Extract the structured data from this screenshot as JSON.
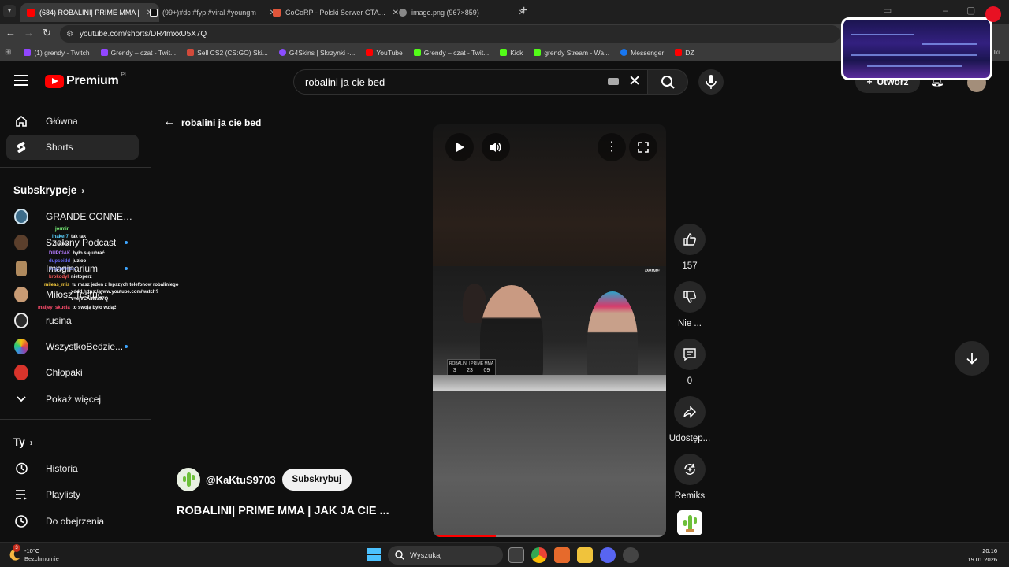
{
  "browser": {
    "tabs": [
      {
        "title": "(684) ROBALINI| PRIME MMA |",
        "active": true,
        "color": "#ff0000"
      },
      {
        "title": "(99+)#dc #fyp #viral #youngm",
        "active": false,
        "color": "#111111"
      },
      {
        "title": "CoCoRP - Polski Serwer GTA RP",
        "active": false,
        "color": "#e0553a"
      },
      {
        "title": "image.png (967×859)",
        "active": false,
        "color": "#888888"
      }
    ],
    "url": "youtube.com/shorts/DR4mxxU5X7Q",
    "bookmarks": [
      {
        "label": "(1) grendy - Twitch",
        "color": "#9146ff"
      },
      {
        "label": "Grendy – czat - Twit...",
        "color": "#9146ff"
      },
      {
        "label": "Sell CS2 (CS:GO) Ski...",
        "color": "#d24a3a"
      },
      {
        "label": "G4Skins | Skrzynki -...",
        "color": "#8a4dff"
      },
      {
        "label": "YouTube",
        "color": "#ff0000"
      },
      {
        "label": "Grendy – czat - Twit...",
        "color": "#53fc18"
      },
      {
        "label": "Kick",
        "color": "#53fc18"
      },
      {
        "label": "grendy Stream - Wa...",
        "color": "#53fc18"
      },
      {
        "label": "Messenger",
        "color": "#1877f2"
      },
      {
        "label": "DZ",
        "color": "#ff0000"
      }
    ],
    "bookmarks_more": "lki"
  },
  "header": {
    "logo_text": "Premium",
    "region": "PL",
    "search_value": "robalini ja cie bed",
    "create_label": "Utwórz"
  },
  "sidebar": {
    "main": [
      {
        "label": "Główna",
        "icon": "home-icon",
        "active": false
      },
      {
        "label": "Shorts",
        "icon": "shorts-icon",
        "active": true
      }
    ],
    "subs_title": "Subskrypcje",
    "subs": [
      {
        "label": "GRANDE CONNECT...",
        "dot": false,
        "color": "#3c6c8a"
      },
      {
        "label": "Szalony Podcast",
        "dot": true,
        "color": "#5b3f2c"
      },
      {
        "label": "Imaginarium",
        "dot": true,
        "color": "#b08a5e"
      },
      {
        "label": "Miłosz Testue",
        "dot": false,
        "color": "#c89b74"
      },
      {
        "label": "rusina",
        "dot": false,
        "color": "#2a2a2a"
      },
      {
        "label": "WszystkoBedzie...",
        "dot": true,
        "color": "#8a4fc7"
      },
      {
        "label": "Chłopaki",
        "dot": false,
        "color": "#d9342b"
      },
      {
        "label": "Pokaż więcej",
        "dot": false,
        "color": ""
      }
    ],
    "you_title": "Ty",
    "you": [
      {
        "label": "Historia",
        "icon": "history-icon"
      },
      {
        "label": "Playlisty",
        "icon": "playlist-icon"
      },
      {
        "label": "Do obejrzenia",
        "icon": "watch-later-icon"
      }
    ]
  },
  "chat": [
    {
      "user": "jormin",
      "text": "",
      "color": "#7fff7f"
    },
    {
      "user": "lnaker7",
      "text": "tak tak",
      "color": "#5ad1ff"
    },
    {
      "user": "rurnix",
      "text": "",
      "color": "#ffffff"
    },
    {
      "user": "DUPCIAK",
      "text": "było się ubrać",
      "color": "#b57cff"
    },
    {
      "user": "dupsoidd",
      "text": "juzioo",
      "color": "#6b6bff"
    },
    {
      "user": "majsonman",
      "text": "",
      "color": "#9aa8ff"
    },
    {
      "user": "krokodyl",
      "text": "nietoperz",
      "color": "#ff5a5a"
    },
    {
      "user": "mileas_mis",
      "text": "tu masz jeden z lepszych telefonow robaliniego",
      "color": "#ffd23f"
    },
    {
      "user": "",
      "text": "xddd https://www.youtube.com/watch?",
      "color": "#ffffff"
    },
    {
      "user": "",
      "text": "v=ejVEAM8s97Q",
      "color": "#ffffff"
    },
    {
      "user": "maljey_skucia",
      "text": "to swoją było wziąć",
      "color": "#ff4d6d"
    }
  ],
  "short": {
    "query": "robalini ja cie bed",
    "channel": "@KaKtuS9703",
    "subscribe_label": "Subskrybuj",
    "title": "ROBALINI| PRIME MMA | JAK JA CIE ...",
    "overlay_logo": "PRIME",
    "overlay_banner": "ROBALINI | PRIME MMA",
    "overlay_counter": [
      "3",
      "23",
      "09"
    ],
    "progress": 0.27,
    "actions": {
      "likes": "157",
      "dislike_label": "Nie ...",
      "comments": "0",
      "share_label": "Udostęp...",
      "remix_label": "Remiks"
    }
  },
  "taskbar": {
    "weather_temp": "-10°C",
    "weather_cond": "Bezchmurnie",
    "weather_badge": "3",
    "search_label": "Wyszukaj",
    "time": "20:16",
    "date": "19.01.2026",
    "rec_label": "REC"
  }
}
